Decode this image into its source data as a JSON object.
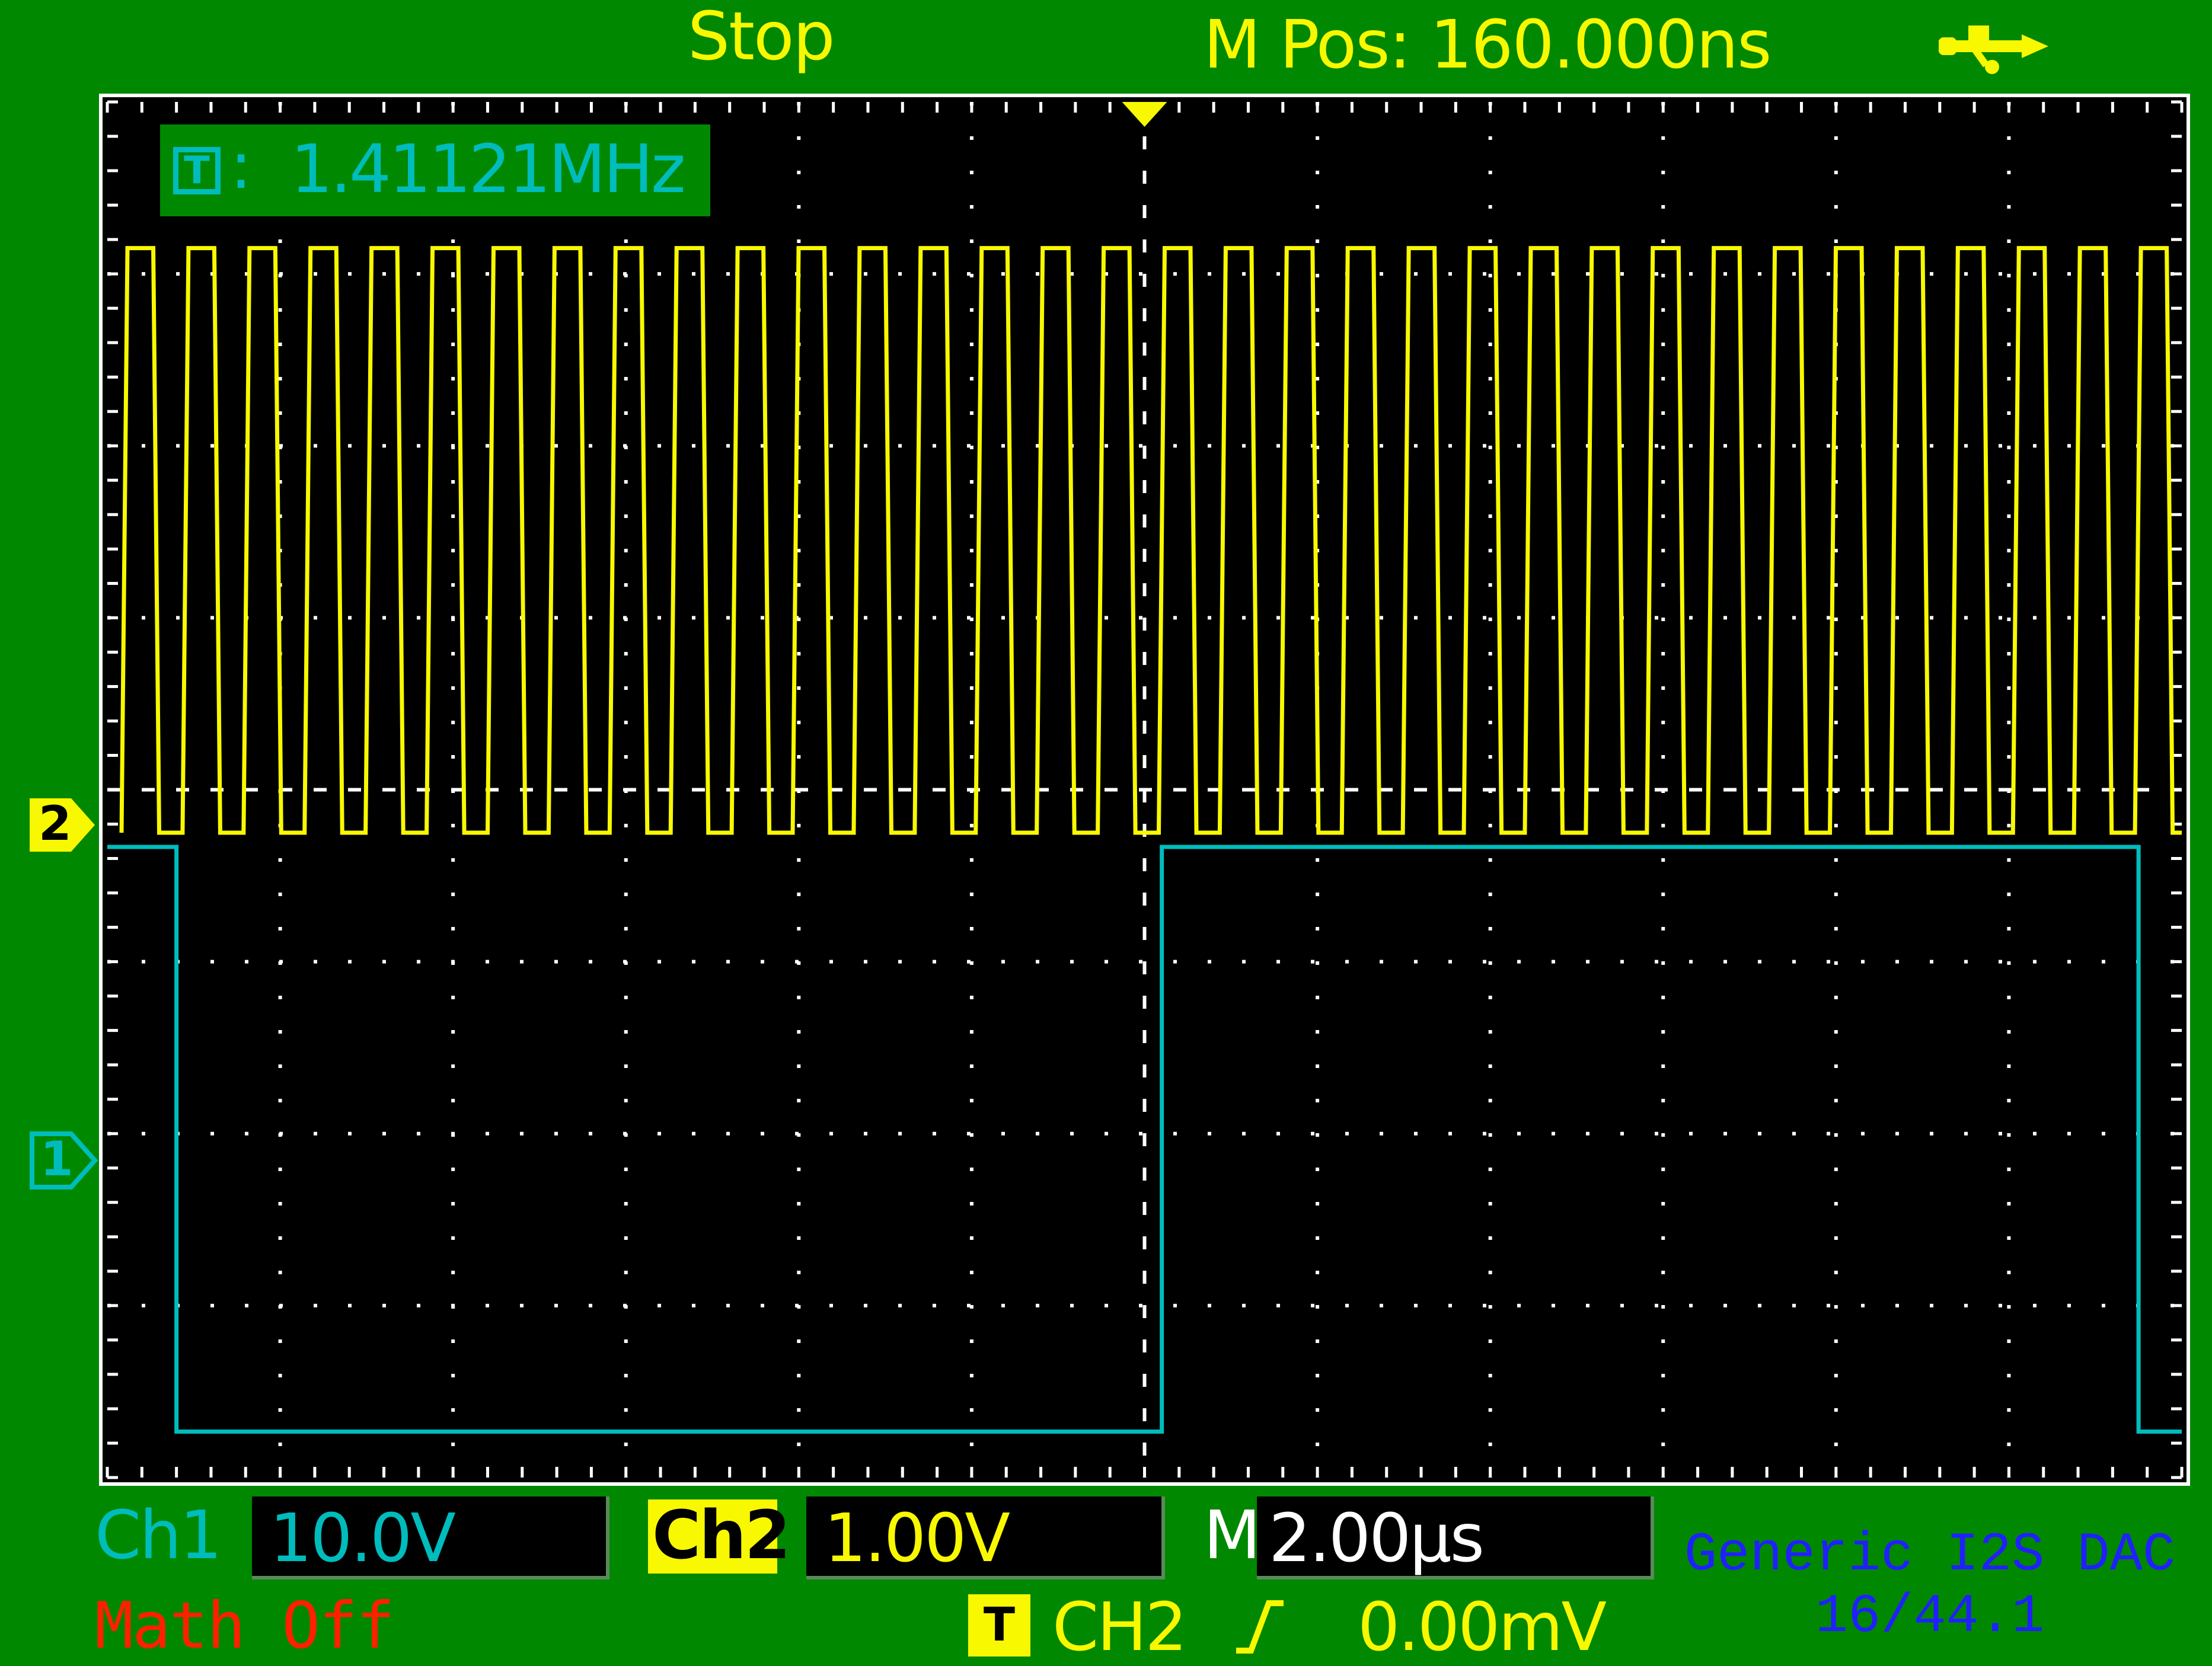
{
  "header": {
    "status": "Stop",
    "m_pos": "M Pos: 160.000ns"
  },
  "icons": {
    "usb": "usb-icon",
    "trigger_position": "trigger-position-arrow-icon"
  },
  "measurement": {
    "icon_text": "T",
    "colon": ":",
    "frequency": "1.41121MHz"
  },
  "markers": {
    "ch2": "2",
    "ch1": "1"
  },
  "footer": {
    "ch1_label": "Ch1",
    "ch1_scale": "10.0V",
    "ch2_label": "Ch2",
    "ch2_scale": "1.00V",
    "m_label": "M",
    "timebase": "2.00µs",
    "math": "Math Off",
    "trigger_icon": "T",
    "trigger_source": "CH2",
    "trigger_level": "0.00mV"
  },
  "caption": {
    "line1": "Generic I2S DAC",
    "line2": "16/44.1"
  },
  "colors": {
    "background": "#008800",
    "ch1": "#00bcbc",
    "ch2": "#f8f800",
    "math": "#ff2000",
    "caption": "#2020ff"
  },
  "chart_data": {
    "type": "line",
    "x_divisions": 12,
    "y_divisions": 8,
    "x_unit_per_div": "2.00µs",
    "series": [
      {
        "name": "Ch2",
        "color": "#f8f800",
        "waveform": "square",
        "frequency": "1.41121MHz",
        "high_div": 3.4,
        "low_div": 0.0
      },
      {
        "name": "Ch1",
        "color": "#00bcbc",
        "waveform": "square",
        "points_div": [
          [
            0,
            0.0
          ],
          [
            0.4,
            0.0
          ],
          [
            0.4,
            -3.4
          ],
          [
            6.1,
            -3.4
          ],
          [
            6.1,
            0.0
          ],
          [
            11.75,
            0.0
          ],
          [
            11.75,
            -3.4
          ],
          [
            12,
            -3.4
          ]
        ]
      }
    ]
  }
}
